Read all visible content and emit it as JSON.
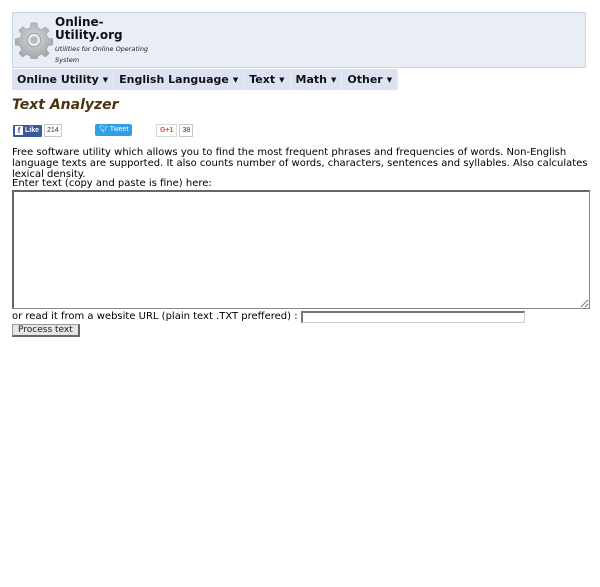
{
  "header": {
    "site_name_line1": "Online-",
    "site_name_line2": "Utility.org",
    "tagline": "Utilities for Online Operating System",
    "logo_icon": "gear-icon"
  },
  "nav": {
    "items": [
      {
        "label": "Online Utility",
        "icon": "caret-down"
      },
      {
        "label": "English Language",
        "icon": "caret-down"
      },
      {
        "label": "Text",
        "icon": "caret-down"
      },
      {
        "label": "Math",
        "icon": "caret-down"
      },
      {
        "label": "Other",
        "icon": "caret-down"
      }
    ]
  },
  "page": {
    "title": "Text Analyzer",
    "description": "Free software utility which allows you to find the most frequent phrases and frequencies of words. Non-English language texts are supported. It also counts number of words, characters, sentences and syllables. Also calculates lexical density."
  },
  "social": {
    "facebook_label": "Like",
    "facebook_count": "214",
    "twitter_label": "Tweet",
    "google_label": "G+1",
    "google_count": "38",
    "colors": {
      "facebook": "#3b5998",
      "twitter": "#2e9fe6",
      "google": "#dd4b39"
    }
  },
  "form": {
    "text_label": "Enter text (copy and paste is fine) here:",
    "text_value": "",
    "url_label": "or read it from a website URL (plain text .TXT preffered) :",
    "url_value": "",
    "submit_label": "Process text"
  }
}
